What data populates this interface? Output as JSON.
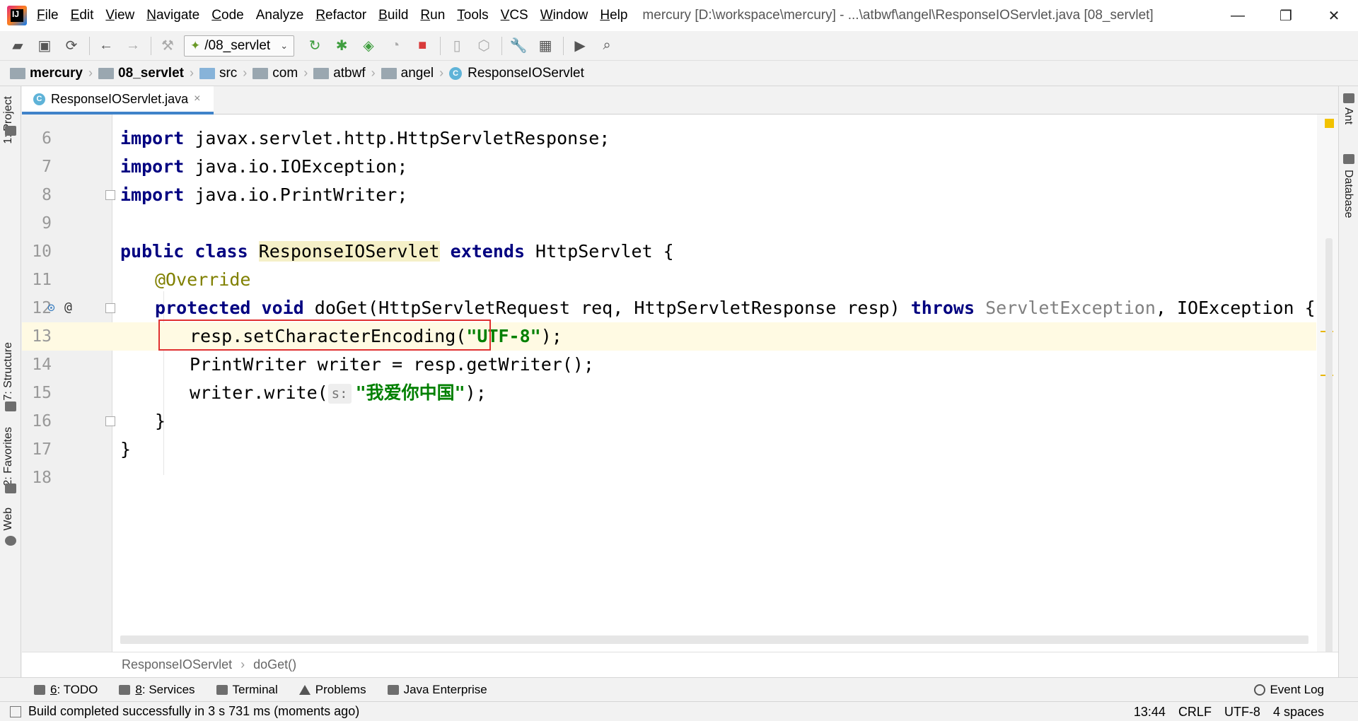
{
  "window": {
    "title": "mercury [D:\\workspace\\mercury] - ...\\atbwf\\angel\\ResponseIOServlet.java [08_servlet]",
    "controls": [
      "—",
      "❐",
      "✕"
    ]
  },
  "menu": [
    {
      "mn": "F",
      "rest": "ile"
    },
    {
      "mn": "E",
      "rest": "dit"
    },
    {
      "mn": "V",
      "rest": "iew"
    },
    {
      "mn": "N",
      "rest": "avigate"
    },
    {
      "mn": "C",
      "rest": "ode"
    },
    {
      "mn": "",
      "rest": "Analyze"
    },
    {
      "mn": "R",
      "rest": "efactor"
    },
    {
      "mn": "B",
      "rest": "uild"
    },
    {
      "mn": "R",
      "rest": "un"
    },
    {
      "mn": "T",
      "rest": "ools"
    },
    {
      "mn": "V",
      "rest": "CS"
    },
    {
      "mn": "W",
      "rest": "indow"
    },
    {
      "mn": "H",
      "rest": "elp"
    }
  ],
  "toolbar": {
    "run_config": "/08_servlet",
    "icons": [
      "open-folder-icon",
      "save-icon",
      "sync-icon",
      "back-arrow-icon",
      "forward-arrow-icon",
      "build-hammer-icon",
      "rerun-icon",
      "debug-bug-icon",
      "coverage-icon",
      "profile-icon",
      "stop-icon",
      "attach-icon",
      "deploy-icon",
      "settings-wrench-icon",
      "project-structure-icon",
      "terminal-run-icon",
      "search-icon"
    ]
  },
  "breadcrumb": [
    "mercury",
    "08_servlet",
    "src",
    "com",
    "atbwf",
    "angel",
    "ResponseIOServlet"
  ],
  "left_tabs": {
    "project": "1: Project",
    "structure": "7: Structure",
    "favorites": "2: Favorites",
    "web": "Web"
  },
  "right_tabs": {
    "ant": "Ant",
    "database": "Database"
  },
  "editor_tab": {
    "file": "ResponseIOServlet.java",
    "close": "×"
  },
  "code_lines": [
    {
      "n": "6"
    },
    {
      "n": "7"
    },
    {
      "n": "8"
    },
    {
      "n": "9"
    },
    {
      "n": "10"
    },
    {
      "n": "11"
    },
    {
      "n": "12"
    },
    {
      "n": "13"
    },
    {
      "n": "14"
    },
    {
      "n": "15"
    },
    {
      "n": "16"
    },
    {
      "n": "17"
    },
    {
      "n": "18"
    }
  ],
  "code": {
    "l6": [
      "import",
      " javax.servlet.http.HttpServletResponse;"
    ],
    "l7": [
      "import",
      " java.io.IOException;"
    ],
    "l8": [
      "import",
      " java.io.PrintWriter;"
    ],
    "l10": [
      "public",
      " ",
      "class",
      " ",
      "ResponseIOServlet",
      " ",
      "extends",
      " HttpServlet {"
    ],
    "l11": [
      "@Override"
    ],
    "l12": [
      "protected",
      " ",
      "void",
      " doGet(HttpServletRequest req, HttpServletResponse resp) ",
      "throws",
      " ",
      "ServletException",
      ", IOException {"
    ],
    "l13": [
      "resp.setCharacterEncoding(",
      "\"UTF-8\"",
      ");"
    ],
    "l14": [
      "PrintWriter writer = resp.getWriter();"
    ],
    "l15": [
      "writer.write(",
      "s:",
      "\"我爱你中国\"",
      ");"
    ],
    "l16": [
      "}"
    ],
    "l17": [
      "}"
    ]
  },
  "editor_crumbs": [
    "ResponseIOServlet",
    "doGet()"
  ],
  "tool_tabs": [
    {
      "mn": "6",
      "rest": ": TODO"
    },
    {
      "mn": "8",
      "rest": ": Services"
    },
    {
      "mn": "",
      "rest": "Terminal"
    },
    {
      "mn": "",
      "rest": "Problems"
    },
    {
      "mn": "",
      "rest": "Java Enterprise"
    }
  ],
  "event_log": "Event Log",
  "status": {
    "message": "Build completed successfully in 3 s 731 ms (moments ago)",
    "position": "13:44",
    "line_sep": "CRLF",
    "encoding": "UTF-8",
    "indent": "4 spaces"
  },
  "colors": {
    "keyword": "#000080",
    "string": "#008000",
    "annotation": "#808000",
    "highlight_box": "#e03030",
    "current_line": "#fffae3"
  }
}
